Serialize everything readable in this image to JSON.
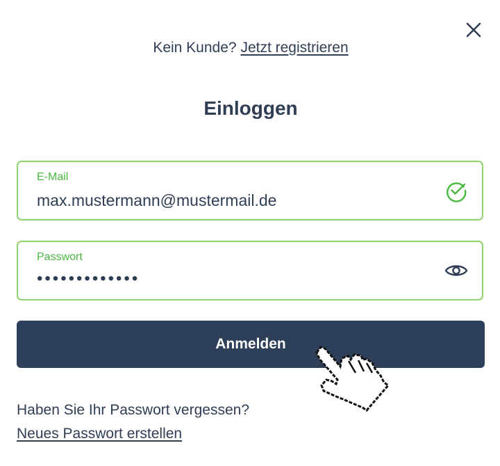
{
  "header": {
    "close_icon": "close-icon",
    "register_prompt": "Kein Kunde?",
    "register_link": "Jetzt registrieren"
  },
  "title": "Einloggen",
  "form": {
    "email": {
      "label": "E-Mail",
      "value": "max.mustermann@mustermail.de",
      "status_icon": "check-circle-icon",
      "valid": true
    },
    "password": {
      "label": "Passwort",
      "masked_value": "•••••••••••••",
      "toggle_icon": "eye-icon"
    },
    "submit_label": "Anmelden"
  },
  "footer": {
    "forgot_question": "Haben Sie Ihr Passwort vergessen?",
    "new_password_link": "Neues Passwort erstellen"
  },
  "colors": {
    "primary_dark": "#2e3f59",
    "text": "#2f3e55",
    "success_green": "#49b83f",
    "field_border_green": "#8ed36e",
    "background": "#ffffff"
  }
}
